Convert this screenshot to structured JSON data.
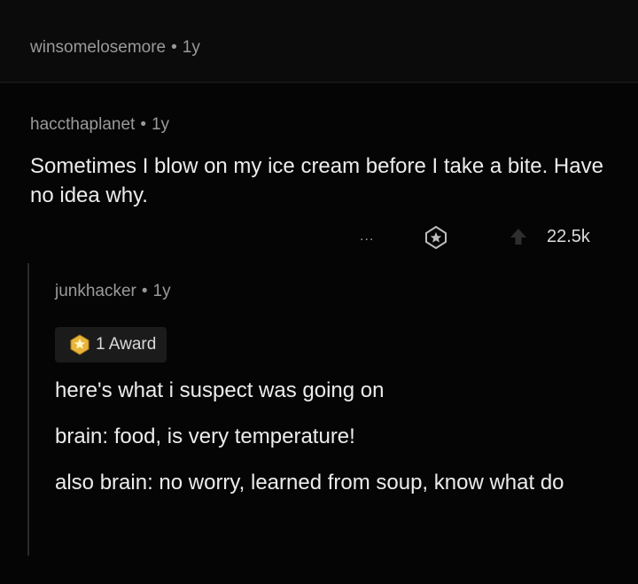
{
  "op": {
    "username": "winsomelosemore",
    "age": "1y"
  },
  "comment": {
    "username": "haccthaplanet",
    "age": "1y",
    "body": "Sometimes I blow on my ice cream before I take a bite. Have no idea why.",
    "more_label": "...",
    "score": "22.5k"
  },
  "reply": {
    "username": "junkhacker",
    "age": "1y",
    "award_label": "1 Award",
    "paragraphs": [
      "here's what i suspect was going on",
      "brain: food, is very temperature!",
      "also brain: no worry, learned from soup, know what do"
    ]
  },
  "colors": {
    "background": "#050505",
    "text": "#ececec",
    "meta": "#9a9a9a",
    "award_gold": "#e8b53a"
  },
  "icons": {
    "more": "more-options-icon",
    "award": "award-icon",
    "upvote": "upvote-arrow-icon",
    "award_badge": "gold-award-icon"
  }
}
